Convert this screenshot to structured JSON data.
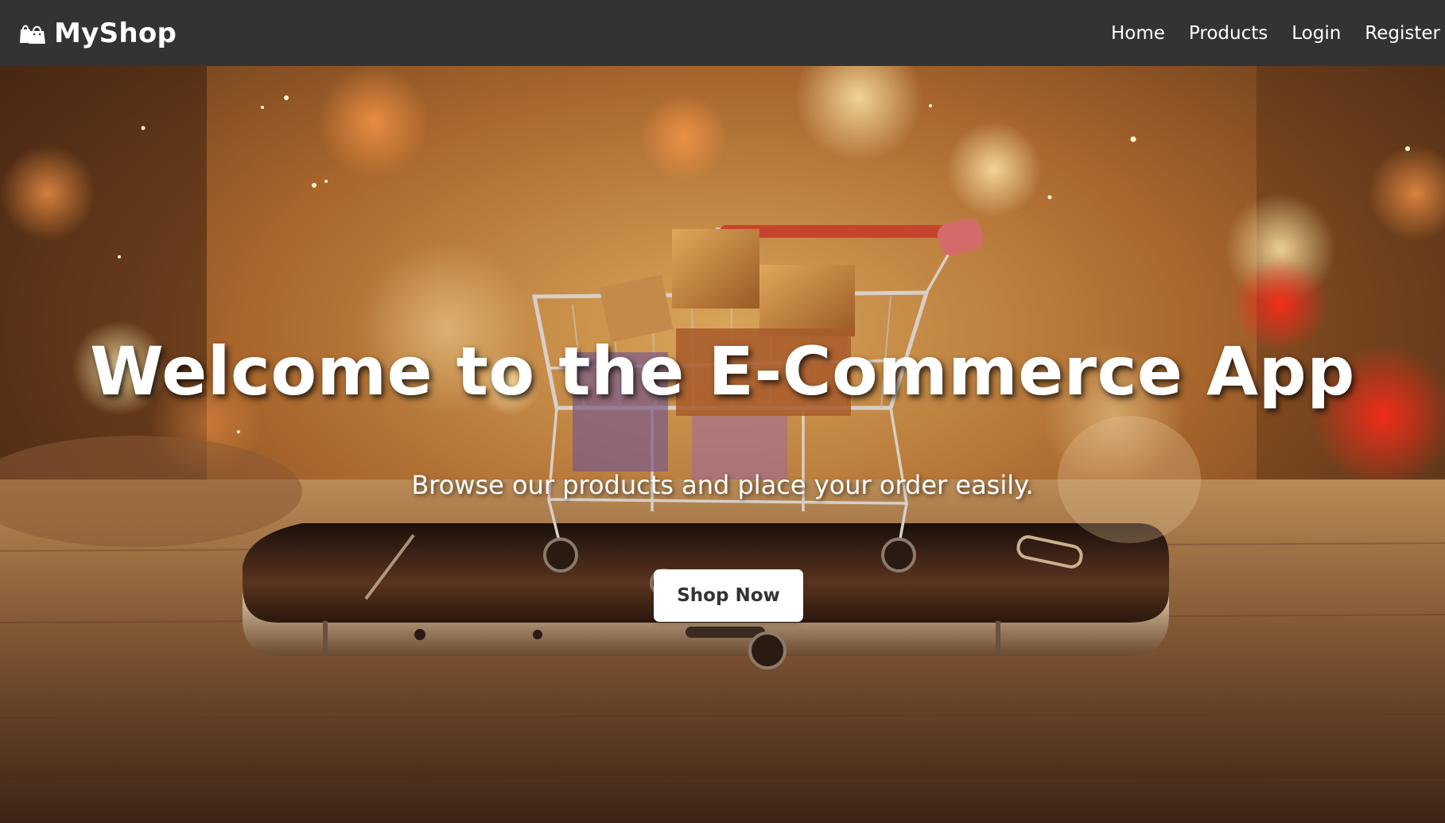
{
  "navbar": {
    "brand_icon": "shopping-bags-icon",
    "brand_name": "MyShop",
    "links": [
      {
        "label": "Home"
      },
      {
        "label": "Products"
      },
      {
        "label": "Login"
      },
      {
        "label": "Register"
      }
    ],
    "background_color": "#333333"
  },
  "hero": {
    "background_image": "shopping-cart-on-smartphone",
    "title": "Welcome to the E-Commerce App",
    "subtitle": "Browse our products and place your order easily.",
    "cta_label": "Shop Now"
  }
}
